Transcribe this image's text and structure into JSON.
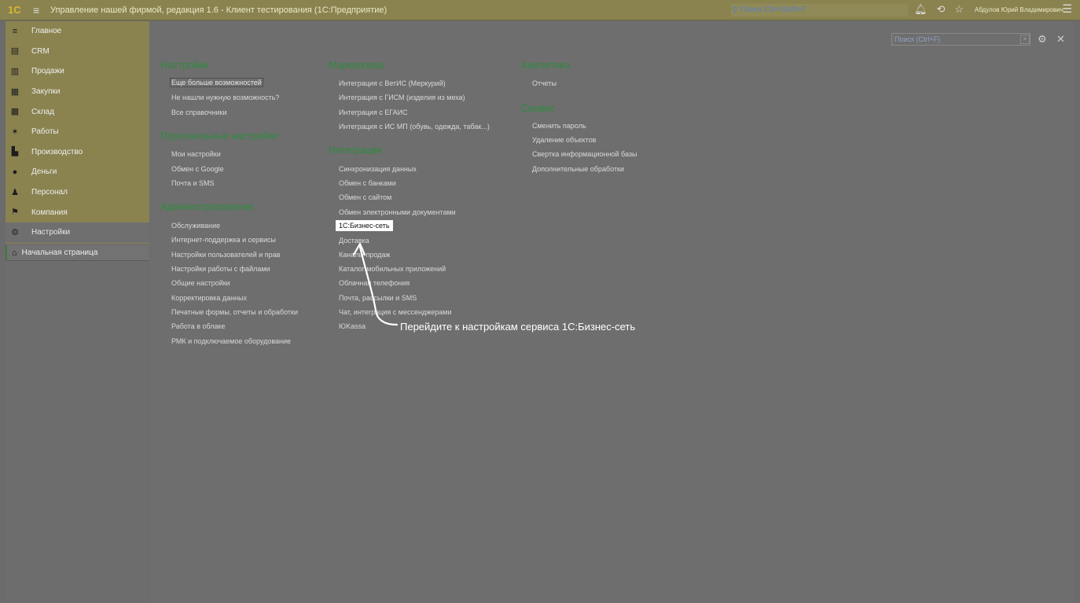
{
  "titlebar": {
    "logo": "1С",
    "title": "Управление нашей фирмой, редакция 1.6  - Клиент тестирования (1С:Предприятие)",
    "search_placeholder": "Поиск Ctrl+Shift+F",
    "user": "Абдулов Юрий Владимирович",
    "icons": [
      "bell-icon",
      "history-icon",
      "star-icon",
      "menu-icon"
    ]
  },
  "sidebar": {
    "items": [
      {
        "label": "Главное",
        "icon": "≡"
      },
      {
        "label": "CRM",
        "icon": "▤"
      },
      {
        "label": "Продажи",
        "icon": "▥"
      },
      {
        "label": "Закупки",
        "icon": "▦"
      },
      {
        "label": "Склад",
        "icon": "▩"
      },
      {
        "label": "Работы",
        "icon": "✶"
      },
      {
        "label": "Производство",
        "icon": "▙"
      },
      {
        "label": "Деньги",
        "icon": "●"
      },
      {
        "label": "Персонал",
        "icon": "♟"
      },
      {
        "label": "Компания",
        "icon": "⚑"
      },
      {
        "label": "Настройки",
        "icon": "⚙"
      }
    ],
    "start_page": "Начальная страница"
  },
  "form": {
    "search_placeholder": "Поиск (Ctrl+F)",
    "clear": "×",
    "gear": "⚙",
    "close": "✕"
  },
  "col1": {
    "settings_title": "Настройки",
    "settings_links": [
      "Еще больше возможностей",
      "Не нашли нужную возможность?",
      "Все справочники"
    ],
    "personal_title": "Персональные настройки",
    "personal_links": [
      "Мои настройки",
      "Обмен с Google",
      "Почта и SMS"
    ],
    "admin_title": "Администрирование",
    "admin_links": [
      "Обслуживание",
      "Интернет-поддержка и сервисы",
      "Настройки пользователей и прав",
      "Настройки работы с файлами",
      "Общие настройки",
      "Корректировка данных",
      "Печатные формы, отчеты и обработки",
      "Работа в облаке",
      "РМК и подключаемое оборудование"
    ]
  },
  "col2": {
    "marking_title": "Маркировка",
    "marking_links": [
      "Интеграция с ВетИС (Меркурий)",
      "Интеграция с ГИСМ (изделия из меха)",
      "Интеграция с ЕГАИС",
      "Интеграция с ИС МП (обувь, одежда, табак...)"
    ],
    "integr_title": "Интеграции",
    "integr_links": [
      "Синхронизация данных",
      "Обмен с банками",
      "Обмен с сайтом",
      "Обмен электронными документами",
      "1С:Бизнес-сеть",
      "Доставка",
      "Каналы продаж",
      "Каталог мобильных приложений",
      "Облачная телефония",
      "Почта, рассылки и SMS",
      "Чат, интеграция с мессенджерами",
      "ЮKassa"
    ]
  },
  "col3": {
    "analytics_title": "Аналитика",
    "analytics_links": [
      "Отчеты"
    ],
    "service_title": "Сервис",
    "service_links": [
      "Сменить пароль",
      "Удаление объектов",
      "Свертка информационной базы",
      "Дополнительные обработки"
    ]
  },
  "hint": "Перейдите к настройкам сервиса 1С:Бизнес-сеть"
}
